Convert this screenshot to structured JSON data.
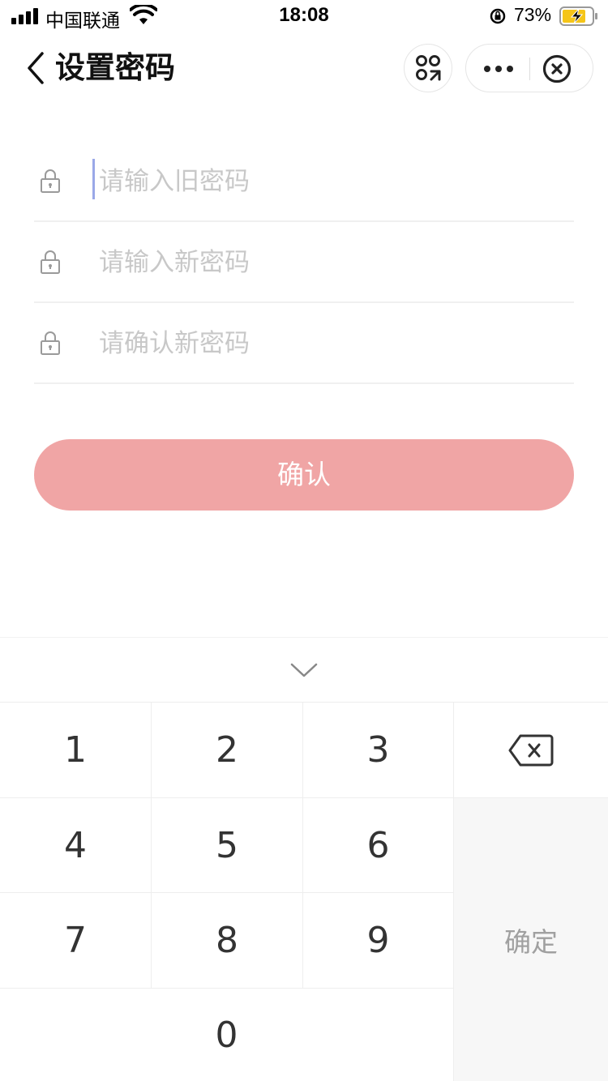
{
  "status_bar": {
    "carrier": "中国联通",
    "time": "18:08",
    "battery_percent": "73%"
  },
  "nav": {
    "title": "设置密码"
  },
  "form": {
    "old_password_placeholder": "请输入旧密码",
    "new_password_placeholder": "请输入新密码",
    "confirm_password_placeholder": "请确认新密码",
    "submit_label": "确认"
  },
  "keyboard": {
    "keys": [
      "1",
      "2",
      "3",
      "4",
      "5",
      "6",
      "7",
      "8",
      "9",
      "0"
    ],
    "ok_label": "确定"
  },
  "colors": {
    "accent_button": "#f0a5a5",
    "caret": "#9aa8e8"
  },
  "icons": [
    "signal-icon",
    "wifi-icon",
    "rotation-lock-icon",
    "battery-icon",
    "back-icon",
    "scan-icon",
    "more-icon",
    "close-icon",
    "lock-icon",
    "chevron-down-icon",
    "backspace-icon"
  ]
}
